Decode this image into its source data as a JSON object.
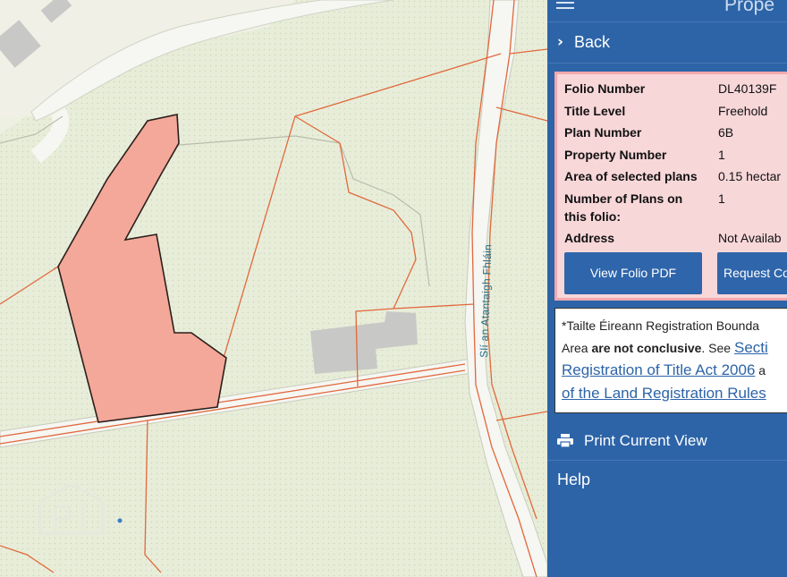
{
  "map": {
    "road_label": "Slí an Atantaigh Fhláin",
    "colors": {
      "background": "#e8edd9",
      "road_fill": "#f6f6f2",
      "boundary": "#e1683c",
      "parcel_fill": "#f4a899",
      "building": "#c8c8c6"
    }
  },
  "panel": {
    "title": "Prope",
    "back_label": "Back",
    "folio": {
      "rows": [
        {
          "label": "Folio Number",
          "value": "DL40139F"
        },
        {
          "label": "Title Level",
          "value": "Freehold"
        },
        {
          "label": "Plan Number",
          "value": "6B"
        },
        {
          "label": "Property Number",
          "value": "1"
        },
        {
          "label": "Area of selected plans",
          "value": "0.15 hectar"
        },
        {
          "label": "Number of Plans on",
          "label2": "this folio:",
          "value": "1"
        },
        {
          "label": "Address",
          "value": "Not Availab"
        }
      ],
      "view_pdf_label": "View Folio PDF",
      "request_label": "Request Co"
    },
    "disclaimer": {
      "line1": "*Tailte Éireann Registration Bounda",
      "line2_pre": "Area ",
      "line2_bold": "are not conclusive",
      "line2_post": ". See ",
      "line2_link": "Secti",
      "line3_link": "Registration of Title Act 2006",
      "line3_post": " a",
      "line4_link": "of the Land Registration Rules"
    },
    "print_label": "Print Current View",
    "help_label": "Help",
    "colors": {
      "panel": "#2d64a8",
      "info_bg": "#f8d7d9",
      "info_border": "#f2a8ad",
      "button": "#2f65aa"
    }
  }
}
